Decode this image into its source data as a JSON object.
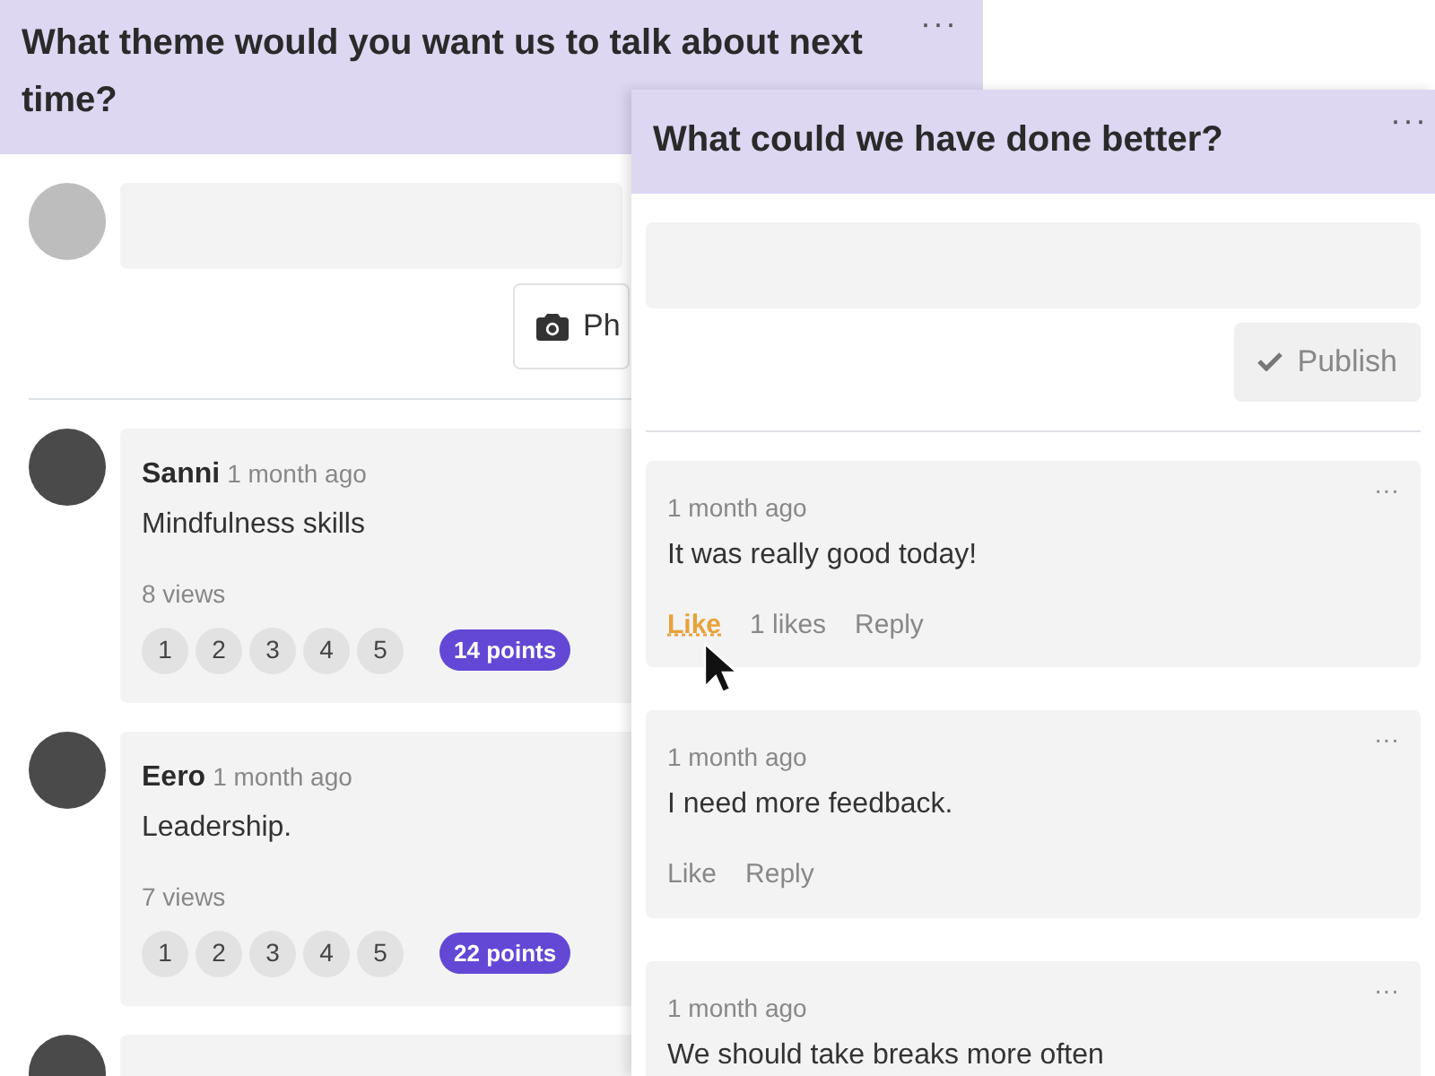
{
  "left_panel": {
    "title": "What theme would you want us to talk about next time?",
    "menu": "···",
    "photo_button": "Ph",
    "comments": [
      {
        "author": "Sanni",
        "time": "1 month ago",
        "text": "Mindfulness skills",
        "views": "8 views",
        "ratings": [
          "1",
          "2",
          "3",
          "4",
          "5"
        ],
        "points": "14 points"
      },
      {
        "author": "Eero",
        "time": "1 month ago",
        "text": "Leadership.",
        "views": "7 views",
        "ratings": [
          "1",
          "2",
          "3",
          "4",
          "5"
        ],
        "points": "22 points"
      }
    ]
  },
  "right_panel": {
    "title": "What could we have done better?",
    "menu": "···",
    "publish_button": "Publish",
    "comments": [
      {
        "time": "1 month ago",
        "text": "It was really good today!",
        "menu": "···",
        "like": "Like",
        "liked": true,
        "likes": "1 likes",
        "reply": "Reply"
      },
      {
        "time": "1 month ago",
        "text": "I need more feedback.",
        "menu": "···",
        "like": "Like",
        "liked": false,
        "reply": "Reply"
      },
      {
        "time": "1 month ago",
        "text": "We should take breaks more often",
        "menu": "···"
      }
    ]
  }
}
